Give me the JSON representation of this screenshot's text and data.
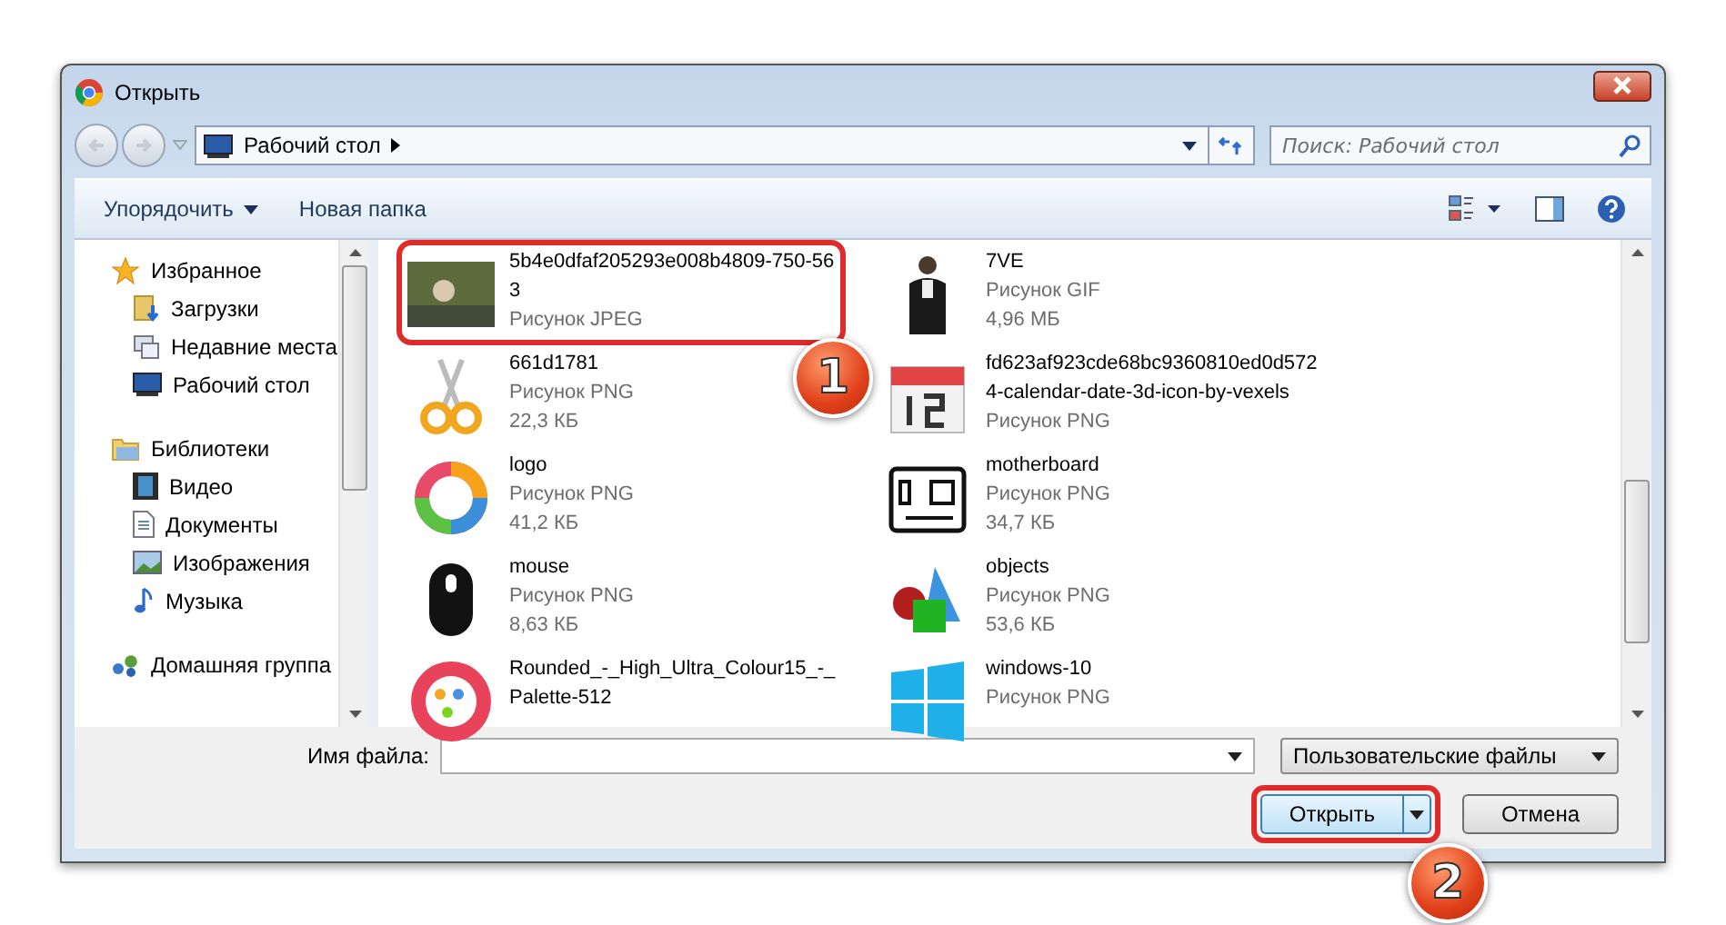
{
  "window": {
    "title": "Открыть"
  },
  "address": {
    "location": "Рабочий стол",
    "search_placeholder": "Поиск: Рабочий стол"
  },
  "toolbar": {
    "organize": "Упорядочить",
    "new_folder": "Новая папка"
  },
  "sidebar": {
    "groups": [
      {
        "label": "Избранное",
        "kind": "star",
        "children": [
          {
            "label": "Загрузки",
            "kind": "download"
          },
          {
            "label": "Недавние места",
            "kind": "recent"
          },
          {
            "label": "Рабочий стол",
            "kind": "desktop"
          }
        ]
      },
      {
        "label": "Библиотеки",
        "kind": "library",
        "children": [
          {
            "label": "Видео",
            "kind": "video"
          },
          {
            "label": "Документы",
            "kind": "doc"
          },
          {
            "label": "Изображения",
            "kind": "image"
          },
          {
            "label": "Музыка",
            "kind": "music"
          }
        ]
      },
      {
        "label": "Домашняя группа",
        "kind": "homegroup"
      }
    ]
  },
  "files": [
    {
      "kind": "photo",
      "name_lines": [
        "5b4e0dfaf205293e008b4809-750-56",
        "3"
      ],
      "type": "Рисунок JPEG",
      "callout": "1"
    },
    {
      "kind": "person",
      "name_lines": [
        "7VE"
      ],
      "type": "Рисунок GIF",
      "size": "4,96 МБ"
    },
    {
      "kind": "scissors",
      "name_lines": [
        "661d1781"
      ],
      "type": "Рисунок PNG",
      "size": "22,3 КБ"
    },
    {
      "kind": "calendar",
      "name_lines": [
        "fd623af923cde68bc9360810ed0d572",
        "4-calendar-date-3d-icon-by-vexels"
      ],
      "type": "Рисунок PNG"
    },
    {
      "kind": "cycle",
      "name_lines": [
        "logo"
      ],
      "type": "Рисунок PNG",
      "size": "41,2 КБ"
    },
    {
      "kind": "board",
      "name_lines": [
        "motherboard"
      ],
      "type": "Рисунок PNG",
      "size": "34,7 КБ"
    },
    {
      "kind": "mouse",
      "name_lines": [
        "mouse"
      ],
      "type": "Рисунок PNG",
      "size": "8,63 КБ"
    },
    {
      "kind": "shapes",
      "name_lines": [
        "objects"
      ],
      "type": "Рисунок PNG",
      "size": "53,6 КБ"
    },
    {
      "kind": "palette",
      "name_lines": [
        "Rounded_-_High_Ultra_Colour15_-_",
        "Palette-512"
      ]
    },
    {
      "kind": "windows",
      "name_lines": [
        "windows-10"
      ],
      "type": "Рисунок PNG"
    }
  ],
  "bottom": {
    "filename_label": "Имя файла:",
    "filter": "Пользовательские файлы",
    "open": {
      "label": "Открыть",
      "callout": "2"
    },
    "cancel": "Отмена"
  }
}
